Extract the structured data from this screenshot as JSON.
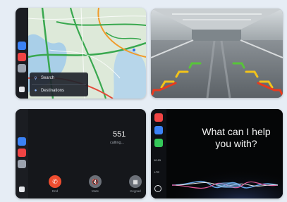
{
  "map_tile": {
    "nav_items": [
      {
        "label": "Search",
        "icon": "search-icon"
      },
      {
        "label": "Destinations",
        "icon": "location-icon"
      }
    ]
  },
  "call_tile": {
    "number": "551",
    "status": "calling...",
    "buttons": [
      {
        "label": "End",
        "icon": "phone-icon",
        "color": "#ef4d2f"
      },
      {
        "label": "Mute",
        "icon": "mute-icon",
        "color": "#6b7078"
      },
      {
        "label": "Keypad",
        "icon": "keypad-icon",
        "color": "#6b7078"
      }
    ]
  },
  "siri_tile": {
    "prompt": "What can I help you with?",
    "status_time": "10:15",
    "status_network": "LTE"
  },
  "colors": {
    "page_bg": "#e6edf5",
    "guide_red": "#e83a1e",
    "guide_yellow": "#f2c31a",
    "guide_green": "#58c43a"
  }
}
